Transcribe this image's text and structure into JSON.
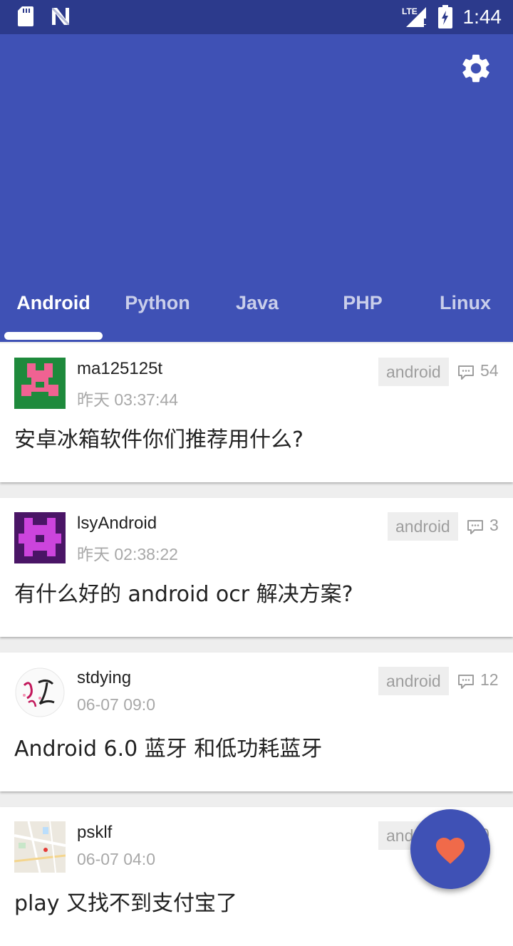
{
  "status_bar": {
    "time": "1:44",
    "icons": [
      "sd-card-icon",
      "n-notification-icon",
      "lte-signal-icon",
      "battery-icon"
    ],
    "lte_label": "LTE"
  },
  "app_bar": {
    "color": "#3f51b5",
    "settings_icon": "gear-icon"
  },
  "tabs": [
    {
      "label": "Android",
      "active": true
    },
    {
      "label": "Python",
      "active": false
    },
    {
      "label": "Java",
      "active": false
    },
    {
      "label": "PHP",
      "active": false
    },
    {
      "label": "Linux",
      "active": false
    }
  ],
  "posts": [
    {
      "username": "ma125125t",
      "time": "昨天 03:37:44",
      "tag": "android",
      "comments": "54",
      "title": "安卓冰箱软件你们推荐用什么?",
      "avatar": "pink-identicon"
    },
    {
      "username": "lsyAndroid",
      "time": "昨天 02:38:22",
      "tag": "android",
      "comments": "3",
      "title": "有什么好的 android ocr 解决方案?",
      "avatar": "purple-identicon"
    },
    {
      "username": "stdying",
      "time": "06-07 09:0",
      "tag": "android",
      "comments": "12",
      "title": "Android 6.0 蓝牙 和低功耗蓝牙",
      "avatar": "calligraphy-avatar"
    },
    {
      "username": "psklf",
      "time": "06-07 04:0",
      "tag": "android",
      "comments": "0",
      "title": "play 又找不到支付宝了",
      "avatar": "map-avatar"
    }
  ],
  "fab": {
    "icon": "heart-icon",
    "color": "#3f51b5",
    "icon_color": "#f06a4a"
  }
}
